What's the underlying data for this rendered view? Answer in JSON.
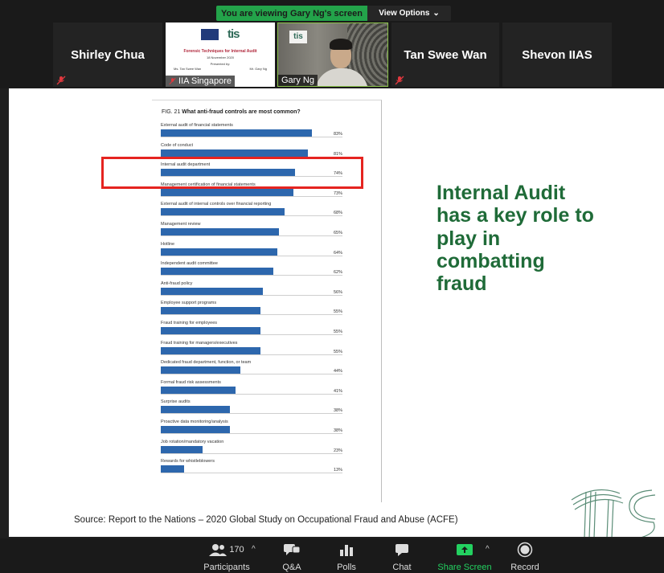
{
  "banner": {
    "viewing_text": "You are viewing Gary Ng's screen",
    "view_options_label": "View Options",
    "view_options_icon": "chevron-down-icon",
    "accent_color": "#23a34a"
  },
  "participants_strip": {
    "tiles": [
      {
        "name": "Shirley Chua",
        "muted": true
      },
      {
        "name": "IIA Singapore",
        "muted": true,
        "thumbnail": {
          "brand": "tis",
          "title": "Forensic Techniques for Internal Audit",
          "date": "18 November 2020",
          "presented_by": "Presented by:",
          "presenter_1": "Ms. Tan Swee Wan",
          "presenter_2": "Mr. Gary Ng"
        }
      },
      {
        "name": "Gary Ng",
        "muted": false,
        "active_speaker": true
      },
      {
        "name": "Tan Swee Wan",
        "muted": true
      },
      {
        "name": "Shevon IIAS",
        "muted": false
      }
    ]
  },
  "slide": {
    "figure_title_prefix": "FIG. 21",
    "figure_title": "What anti-fraud controls are most common?",
    "callout_lines": [
      "Internal Audit",
      "has a key role to",
      "play in",
      "combatting",
      "fraud"
    ],
    "callout_color": "#1f6b38",
    "highlight_color": "#e52420",
    "source": "Source: Report to the Nations – 2020 Global Study on Occupational Fraud and Abuse (ACFE)",
    "watermark": "tis"
  },
  "chart_data": {
    "type": "bar",
    "orientation": "horizontal",
    "title": "What anti-fraud controls are most common?",
    "categories": [
      "External audit of financial statements",
      "Code of conduct",
      "Internal audit department",
      "Management certification of financial statements",
      "External audit of internal controls over financial reporting",
      "Management review",
      "Hotline",
      "Independent audit committee",
      "Anti-fraud policy",
      "Employee support programs",
      "Fraud training for employees",
      "Fraud training for managers/executives",
      "Dedicated fraud department, function, or team",
      "Formal fraud risk assessments",
      "Surprise audits",
      "Proactive data monitoring/analysis",
      "Job rotation/mandatory vacation",
      "Rewards for whistleblowers"
    ],
    "values": [
      83,
      81,
      74,
      73,
      68,
      65,
      64,
      62,
      56,
      55,
      55,
      55,
      44,
      41,
      38,
      38,
      23,
      13
    ],
    "value_labels": [
      "83%",
      "81%",
      "74%",
      "73%",
      "68%",
      "65%",
      "64%",
      "62%",
      "56%",
      "55%",
      "55%",
      "55%",
      "44%",
      "41%",
      "38%",
      "38%",
      "23%",
      "13%"
    ],
    "xlim": [
      0,
      100
    ],
    "bar_color": "#2d67ad",
    "highlighted_category": "Internal audit department"
  },
  "toolbar": {
    "participants": {
      "label": "Participants",
      "count": "170",
      "icon": "participants-icon"
    },
    "qa": {
      "label": "Q&A",
      "icon": "qa-icon"
    },
    "polls": {
      "label": "Polls",
      "icon": "polls-icon"
    },
    "chat": {
      "label": "Chat",
      "icon": "chat-icon"
    },
    "share": {
      "label": "Share Screen",
      "icon": "share-screen-icon",
      "color": "#23d160"
    },
    "record": {
      "label": "Record",
      "icon": "record-icon"
    }
  }
}
